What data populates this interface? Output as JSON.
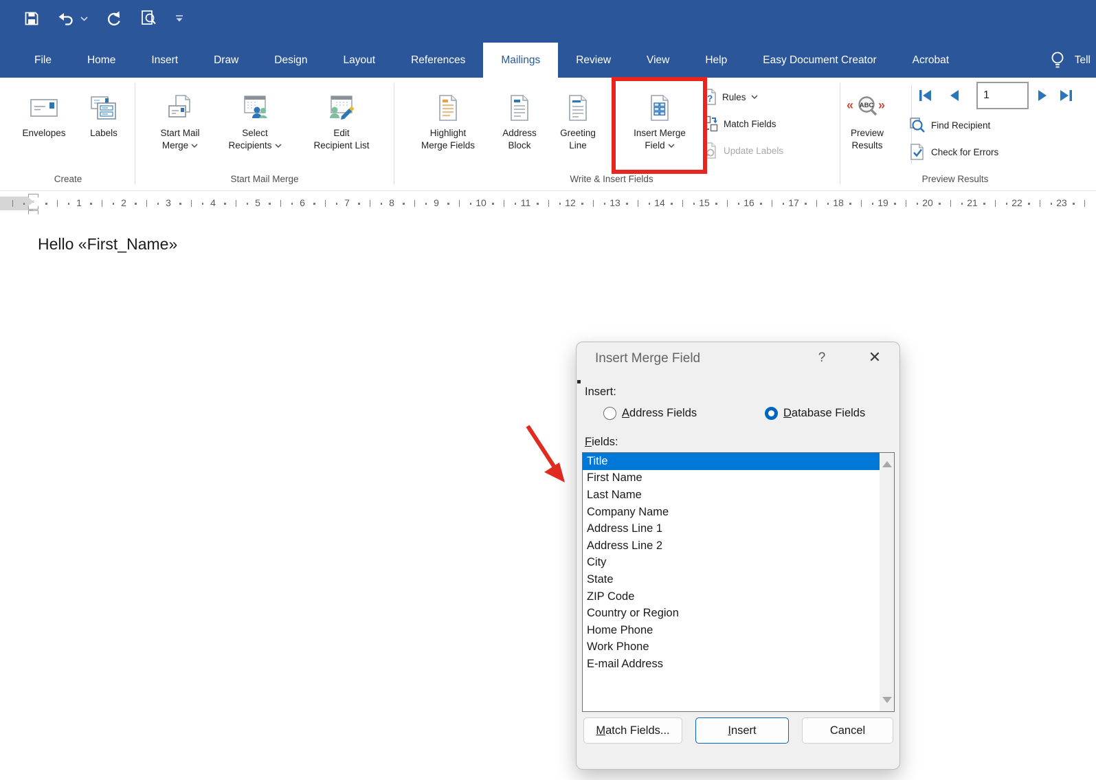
{
  "colors": {
    "brand_blue": "#2b579a",
    "selection_blue": "#0078d7",
    "annotation_red": "#e8261f",
    "icon_blue": "#2e75b6",
    "icon_green": "#7fbf9e"
  },
  "quick_access": {
    "icons": [
      "save-icon",
      "undo-icon",
      "undo-dropdown",
      "redo-icon",
      "print-preview-icon",
      "customize-qat-icon"
    ]
  },
  "tabs": [
    {
      "label": "File"
    },
    {
      "label": "Home"
    },
    {
      "label": "Insert"
    },
    {
      "label": "Draw"
    },
    {
      "label": "Design"
    },
    {
      "label": "Layout"
    },
    {
      "label": "References"
    },
    {
      "label": "Mailings",
      "active": true
    },
    {
      "label": "Review"
    },
    {
      "label": "View"
    },
    {
      "label": "Help"
    },
    {
      "label": "Easy Document Creator"
    },
    {
      "label": "Acrobat"
    }
  ],
  "tell_me": "Tell",
  "ribbon": {
    "create": {
      "group_label": "Create",
      "envelopes": "Envelopes",
      "labels": "Labels"
    },
    "start_mail_merge": {
      "group_label": "Start Mail Merge",
      "start_mail_merge_l1": "Start Mail",
      "start_mail_merge_l2": "Merge",
      "select_recipients_l1": "Select",
      "select_recipients_l2": "Recipients",
      "edit_recipient_list_l1": "Edit",
      "edit_recipient_list_l2": "Recipient List"
    },
    "write_insert": {
      "group_label": "Write & Insert Fields",
      "highlight_l1": "Highlight",
      "highlight_l2": "Merge Fields",
      "address_block_l1": "Address",
      "address_block_l2": "Block",
      "greeting_line_l1": "Greeting",
      "greeting_line_l2": "Line",
      "insert_merge_field_l1": "Insert Merge",
      "insert_merge_field_l2": "Field",
      "rules": "Rules",
      "match_fields": "Match Fields",
      "update_labels": "Update Labels"
    },
    "preview_results": {
      "group_label": "Preview Results",
      "preview_l1": "Preview",
      "preview_l2": "Results",
      "record_number": "1",
      "find_recipient": "Find Recipient",
      "check_for_errors": "Check for Errors"
    }
  },
  "ruler": {
    "numbers": [
      1,
      2,
      3,
      4,
      5,
      6,
      7,
      8,
      9,
      10,
      11,
      12,
      13,
      14,
      15,
      16,
      17,
      18,
      19,
      20,
      21,
      22,
      23
    ]
  },
  "document": {
    "text": "Hello «First_Name»"
  },
  "dialog": {
    "title": "Insert Merge Field",
    "help": "?",
    "close": "✕",
    "insert_label": "Insert:",
    "address_fields": {
      "key": "A",
      "rest": "ddress Fields"
    },
    "database_fields": {
      "key": "D",
      "rest": "atabase Fields"
    },
    "fields_label": {
      "key": "F",
      "rest": "ields:"
    },
    "fields": [
      {
        "label": "Title",
        "selected": true
      },
      {
        "label": "First Name"
      },
      {
        "label": "Last Name"
      },
      {
        "label": "Company Name"
      },
      {
        "label": "Address Line 1"
      },
      {
        "label": "Address Line 2"
      },
      {
        "label": "City"
      },
      {
        "label": "State"
      },
      {
        "label": "ZIP Code"
      },
      {
        "label": "Country or Region"
      },
      {
        "label": "Home Phone"
      },
      {
        "label": "Work Phone"
      },
      {
        "label": "E-mail Address"
      }
    ],
    "buttons": {
      "match_fields": {
        "key": "M",
        "rest": "atch Fields..."
      },
      "insert": {
        "key": "I",
        "rest": "nsert"
      },
      "cancel": "Cancel"
    }
  }
}
